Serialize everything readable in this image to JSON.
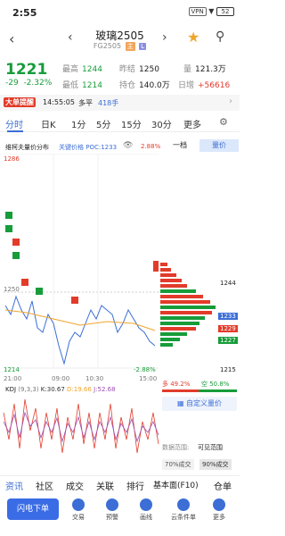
{
  "status": {
    "time": "2:55",
    "icons": "VPN",
    "battery": "52"
  },
  "nav": {
    "title": "玻璃2505",
    "code": "FG2505",
    "tag1": "主",
    "tag2": "L"
  },
  "quote": {
    "price": "1221",
    "change": "-29",
    "change_pct": "-2.32%",
    "high_label": "最高",
    "high": "1244",
    "low_label": "最低",
    "low": "1214",
    "prev_label": "昨结",
    "prev": "1250",
    "oi_label": "持仓",
    "oi": "140.0万",
    "vol_label": "量",
    "vol": "121.3万",
    "dz_label": "日增",
    "dz": "+56616"
  },
  "news": {
    "badge": "大单提醒",
    "time": "14:55:05",
    "type": "多平",
    "qty": "418手"
  },
  "tabs": [
    "分时",
    "日K",
    "1分",
    "5分",
    "15分",
    "30分",
    "更多"
  ],
  "chart_labels": {
    "left": "维柯夫量价分布",
    "poc": "关键价格 POC:1233",
    "top_pct": "2.88%",
    "bottom_pct": "-2.88%",
    "top_price": "1286",
    "bottom_price": "1214",
    "mid_price": "1250",
    "times": [
      "21:00",
      "09:00",
      "10:30",
      "15:00"
    ]
  },
  "right_panel": {
    "tab1": "一档",
    "tab2": "量价",
    "levels": [
      "1244",
      "1233",
      "1229",
      "1227",
      "1215"
    ],
    "buy_pct": "多 49.2%",
    "sell_pct": "空 50.8%",
    "custom": "自定义量价",
    "range_label": "数据范围:",
    "range_value": "可见范围",
    "pct70": "70%成交",
    "pct90": "90%成交"
  },
  "kdj": {
    "label": "KDJ",
    "params": "(9,3,3)",
    "k": "K:30.67",
    "d": "D:19.66",
    "j": "J:52.68"
  },
  "bottom_tabs": [
    "资讯",
    "社区",
    "成交",
    "关联",
    "排行",
    "基本面(F10)",
    "仓单"
  ],
  "actions": {
    "flash": "闪电下单",
    "items": [
      "交易",
      "预警",
      "画线",
      "云条件单",
      "更多"
    ]
  },
  "colors": {
    "up": "#e23b2a",
    "down": "#179c3a",
    "accent": "#3c6ed6"
  }
}
